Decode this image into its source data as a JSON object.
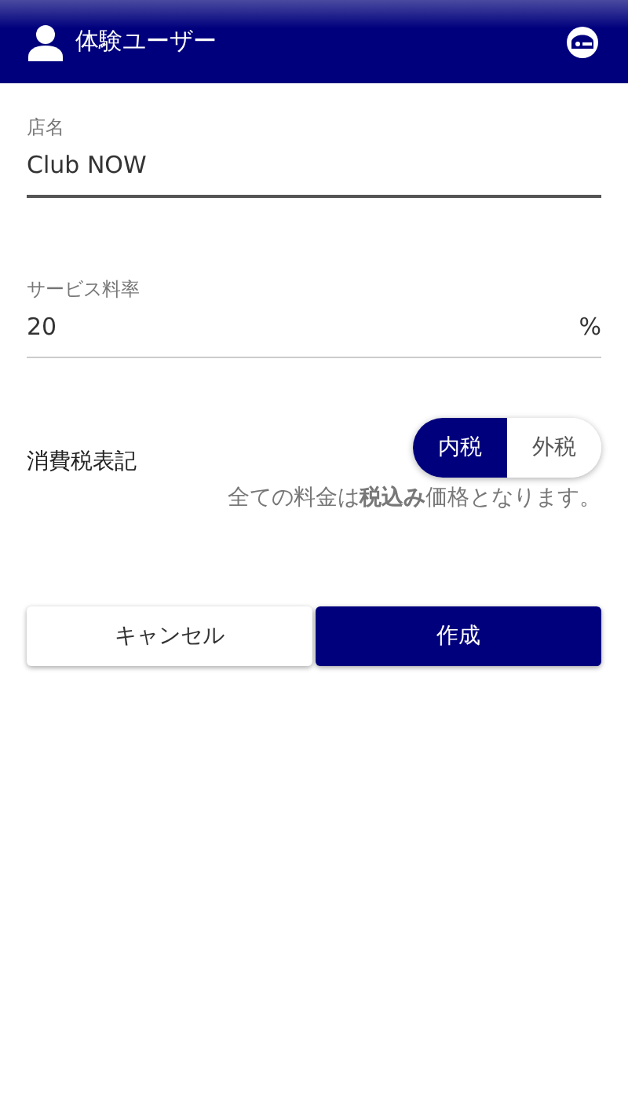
{
  "header": {
    "title": "体験ユーザー"
  },
  "fields": [
    {
      "label": "店名",
      "value": "Club NOW",
      "focused": true
    },
    {
      "label": "サービス料率",
      "value": "20",
      "unit": "%",
      "focused": false
    }
  ],
  "tax": {
    "label": "消費税表記",
    "options": [
      {
        "label": "内税",
        "selected": true
      },
      {
        "label": "外税",
        "selected": false
      }
    ],
    "note": "全ての料金は**税込み**価格となります。"
  },
  "buttons": [
    {
      "label": "キャンセル",
      "kind": "secondary"
    },
    {
      "label": "作成",
      "kind": "primary"
    }
  ]
}
